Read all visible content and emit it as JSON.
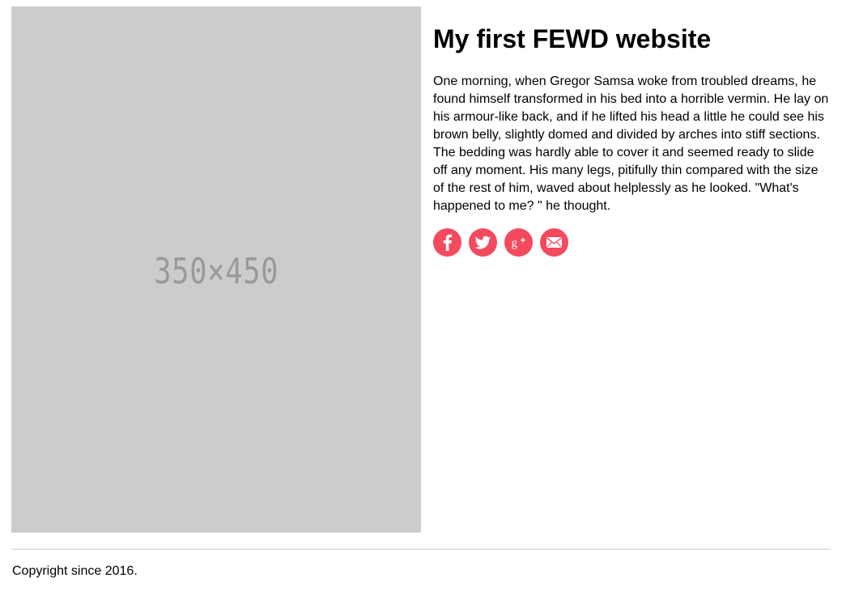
{
  "hero_image": {
    "placeholder_label": "350×450"
  },
  "main": {
    "title": "My first FEWD website",
    "paragraph": "One morning, when Gregor Samsa woke from troubled dreams, he found himself transformed in his bed into a horrible vermin. He lay on his armour-like back, and if he lifted his head a little he could see his brown belly, slightly domed and divided by arches into stiff sections. The bedding was hardly able to cover it and seemed ready to slide off any moment. His many legs, pitifully thin compared with the size of the rest of him, waved about helplessly as he looked. \"What's happened to me? \" he thought."
  },
  "social": {
    "accent_color": "#f44a5e",
    "icons": [
      "facebook-icon",
      "twitter-icon",
      "google-plus-icon",
      "email-icon"
    ]
  },
  "footer": {
    "copyright": "Copyright since 2016."
  }
}
